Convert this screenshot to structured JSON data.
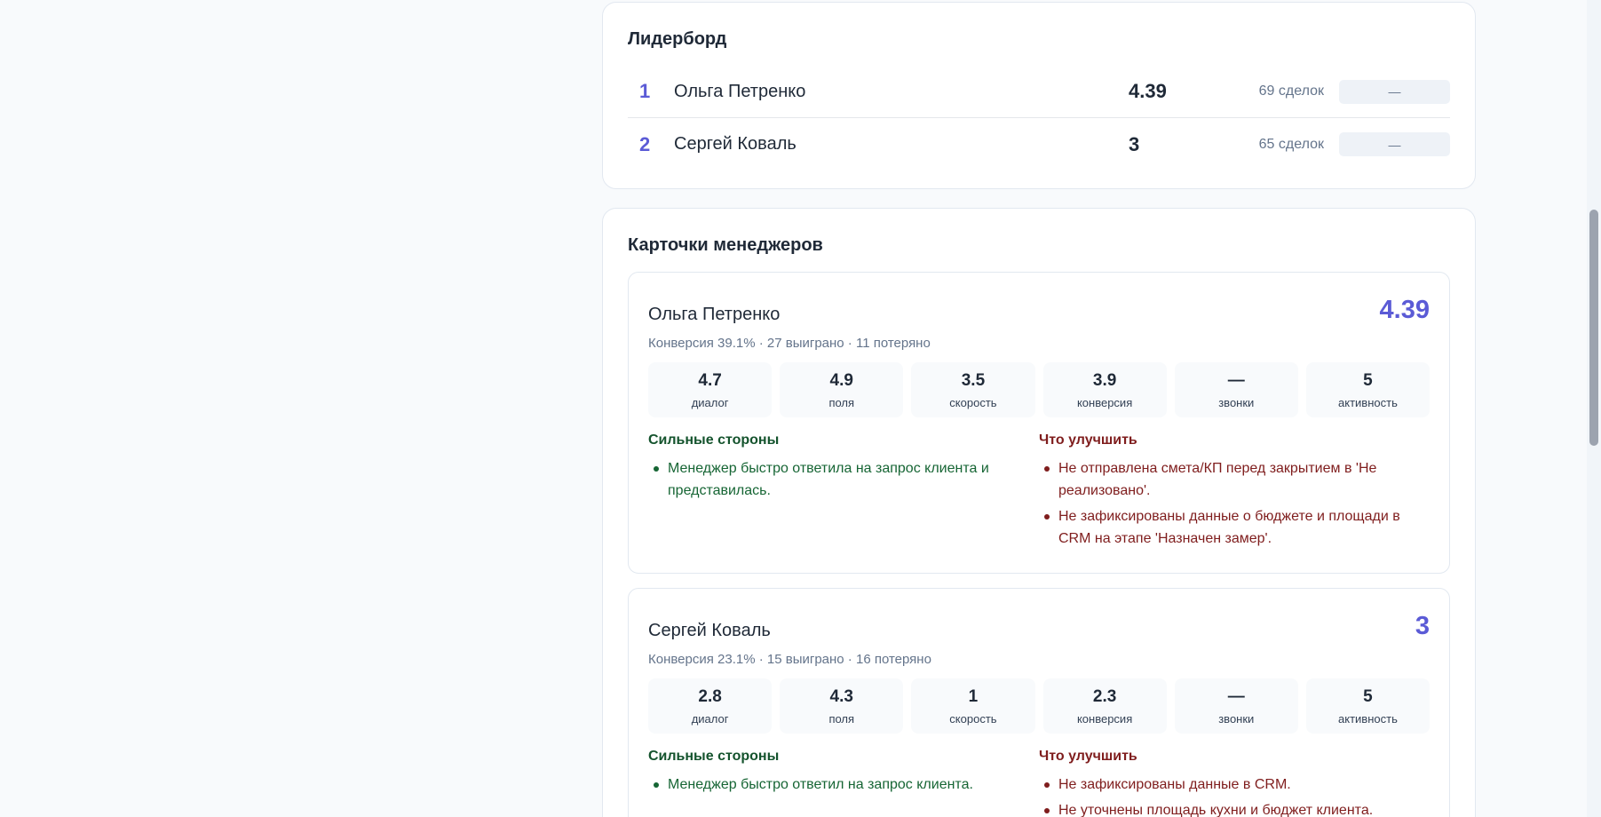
{
  "leaderboard": {
    "title": "Лидерборд",
    "rows": [
      {
        "rank": "1",
        "name": "Ольга Петренко",
        "score": "4.39",
        "deals": "69 сделок",
        "extra": "—"
      },
      {
        "rank": "2",
        "name": "Сергей Коваль",
        "score": "3",
        "deals": "65 сделок",
        "extra": "—"
      }
    ]
  },
  "managers": {
    "title": "Карточки менеджеров",
    "cards": [
      {
        "name": "Ольга Петренко",
        "score": "4.39",
        "subtitle": "Конверсия 39.1% · 27 выиграно · 11 потеряно",
        "metrics": [
          {
            "value": "4.7",
            "label": "диалог"
          },
          {
            "value": "4.9",
            "label": "поля"
          },
          {
            "value": "3.5",
            "label": "скорость"
          },
          {
            "value": "3.9",
            "label": "конверсия"
          },
          {
            "value": "—",
            "label": "звонки"
          },
          {
            "value": "5",
            "label": "активность"
          }
        ],
        "strengths_title": "Сильные стороны",
        "strengths": [
          "Менеджер быстро ответила на запрос клиента и представилась."
        ],
        "improve_title": "Что улучшить",
        "improve": [
          "Не отправлена смета/КП перед закрытием в 'Не реализовано'.",
          "Не зафиксированы данные о бюджете и площади в CRM на этапе 'Назначен замер'."
        ]
      },
      {
        "name": "Сергей Коваль",
        "score": "3",
        "subtitle": "Конверсия 23.1% · 15 выиграно · 16 потеряно",
        "metrics": [
          {
            "value": "2.8",
            "label": "диалог"
          },
          {
            "value": "4.3",
            "label": "поля"
          },
          {
            "value": "1",
            "label": "скорость"
          },
          {
            "value": "2.3",
            "label": "конверсия"
          },
          {
            "value": "—",
            "label": "звонки"
          },
          {
            "value": "5",
            "label": "активность"
          }
        ],
        "strengths_title": "Сильные стороны",
        "strengths": [
          "Менеджер быстро ответил на запрос клиента."
        ],
        "improve_title": "Что улучшить",
        "improve": [
          "Не зафиксированы данные в CRM.",
          "Не уточнены площадь кухни и бюджет клиента."
        ]
      }
    ]
  }
}
